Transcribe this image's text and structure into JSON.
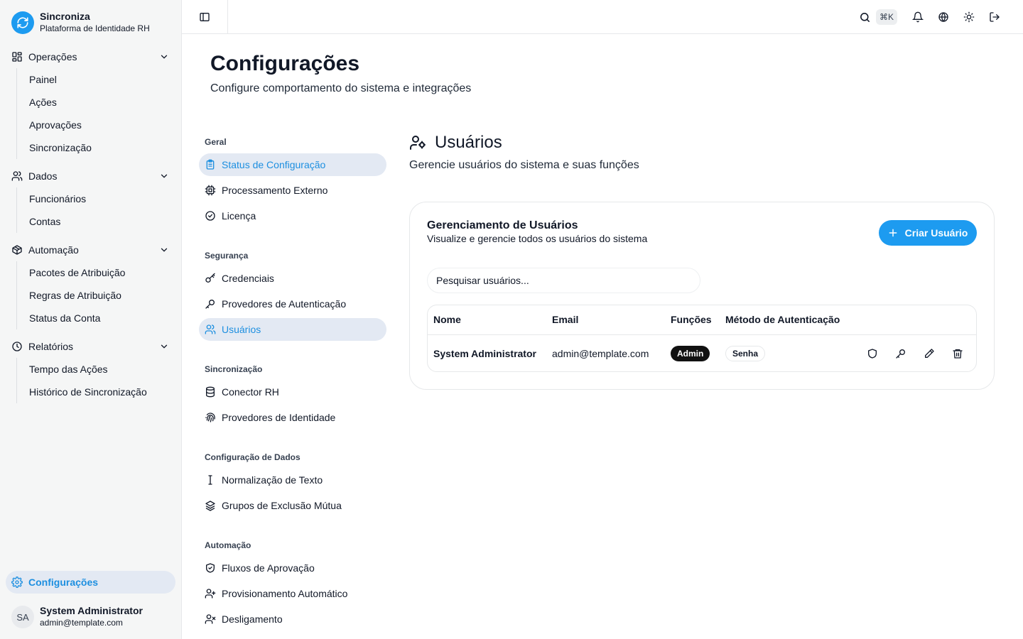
{
  "brand": {
    "name": "Sincroniza",
    "subtitle": "Plataforma de Identidade RH"
  },
  "sidebar": {
    "groups": [
      {
        "label": "Operações",
        "icon": "layout-grid-icon",
        "items": [
          "Painel",
          "Ações",
          "Aprovações",
          "Sincronização"
        ]
      },
      {
        "label": "Dados",
        "icon": "users-icon",
        "items": [
          "Funcionários",
          "Contas"
        ]
      },
      {
        "label": "Automação",
        "icon": "package-icon",
        "items": [
          "Pacotes de Atribuição",
          "Regras de Atribuição",
          "Status da Conta"
        ]
      },
      {
        "label": "Relatórios",
        "icon": "clock-icon",
        "items": [
          "Tempo das Ações",
          "Histórico de Sincronização"
        ]
      }
    ],
    "settings_label": "Configurações",
    "user": {
      "initials": "SA",
      "name": "System Administrator",
      "email": "admin@template.com"
    }
  },
  "topbar": {
    "shortcut": "⌘K",
    "icons": [
      "panel-left-icon",
      "search-icon",
      "bell-icon",
      "globe-icon",
      "sun-icon",
      "logout-icon"
    ]
  },
  "page": {
    "title": "Configurações",
    "subtitle": "Configure comportamento do sistema e integrações"
  },
  "settings_nav": {
    "sections": [
      {
        "heading": "Geral",
        "items": [
          {
            "label": "Status de Configuração",
            "icon": "clipboard-icon",
            "active": true
          },
          {
            "label": "Processamento Externo",
            "icon": "cpu-icon"
          },
          {
            "label": "Licença",
            "icon": "circle-check-icon"
          }
        ]
      },
      {
        "heading": "Segurança",
        "items": [
          {
            "label": "Credenciais",
            "icon": "key-round-icon"
          },
          {
            "label": "Provedores de Autenticação",
            "icon": "key-icon"
          },
          {
            "label": "Usuários",
            "icon": "users-icon",
            "active": true
          }
        ]
      },
      {
        "heading": "Sincronização",
        "items": [
          {
            "label": "Conector RH",
            "icon": "database-icon"
          },
          {
            "label": "Provedores de Identidade",
            "icon": "fingerprint-icon"
          }
        ]
      },
      {
        "heading": "Configuração de Dados",
        "items": [
          {
            "label": "Normalização de Texto",
            "icon": "text-cursor-icon"
          },
          {
            "label": "Grupos de Exclusão Mútua",
            "icon": "layers-icon"
          }
        ]
      },
      {
        "heading": "Automação",
        "items": [
          {
            "label": "Fluxos de Aprovação",
            "icon": "shield-check-icon"
          },
          {
            "label": "Provisionamento Automático",
            "icon": "user-plus-icon"
          },
          {
            "label": "Desligamento",
            "icon": "user-x-icon"
          }
        ]
      }
    ]
  },
  "content": {
    "title": "Usuários",
    "subtitle": "Gerencie usuários do sistema e suas funções",
    "card": {
      "title": "Gerenciamento de Usuários",
      "subtitle": "Visualize e gerencie todos os usuários do sistema",
      "create_button": "Criar Usuário",
      "search_placeholder": "Pesquisar usuários...",
      "columns": [
        "Nome",
        "Email",
        "Funções",
        "Método de Autenticação"
      ],
      "rows": [
        {
          "name": "System Administrator",
          "email": "admin@template.com",
          "role": "Admin",
          "auth_method": "Senha"
        }
      ]
    }
  },
  "colors": {
    "accent": "#1d9bf0",
    "active_bg": "#e3e9f3",
    "active_text": "#1d8fe0"
  }
}
